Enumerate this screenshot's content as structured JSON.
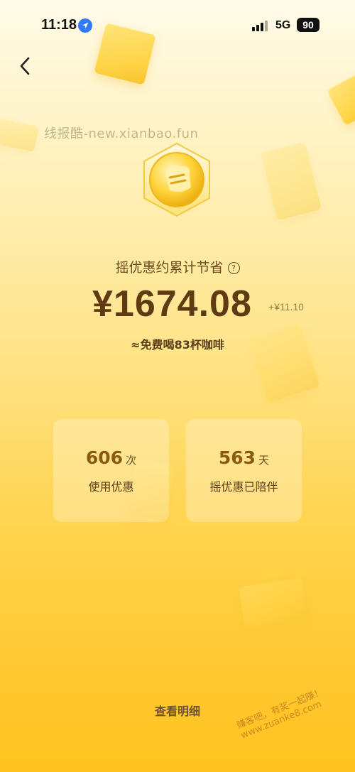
{
  "status_bar": {
    "time": "11:18",
    "network": "5G",
    "battery": "90"
  },
  "watermark": "线报酷-new.xianbao.fun",
  "caption": "摇优惠约累计节省",
  "savings": {
    "amount": "¥1674.08",
    "delta": "+¥11.10",
    "equivalent": "≈免费喝83杯咖啡"
  },
  "stats": [
    {
      "value": "606",
      "unit": "次",
      "label": "使用优惠"
    },
    {
      "value": "563",
      "unit": "天",
      "label": "摇优惠已陪伴"
    }
  ],
  "details_link": "查看明细",
  "corner_watermark": "赚客吧，有奖一起赚！ www.zuanke8.com",
  "colors": {
    "primary_text": "#5f3a12",
    "accent_gold": "#ffd24a",
    "location_blue": "#2f7bf6"
  }
}
